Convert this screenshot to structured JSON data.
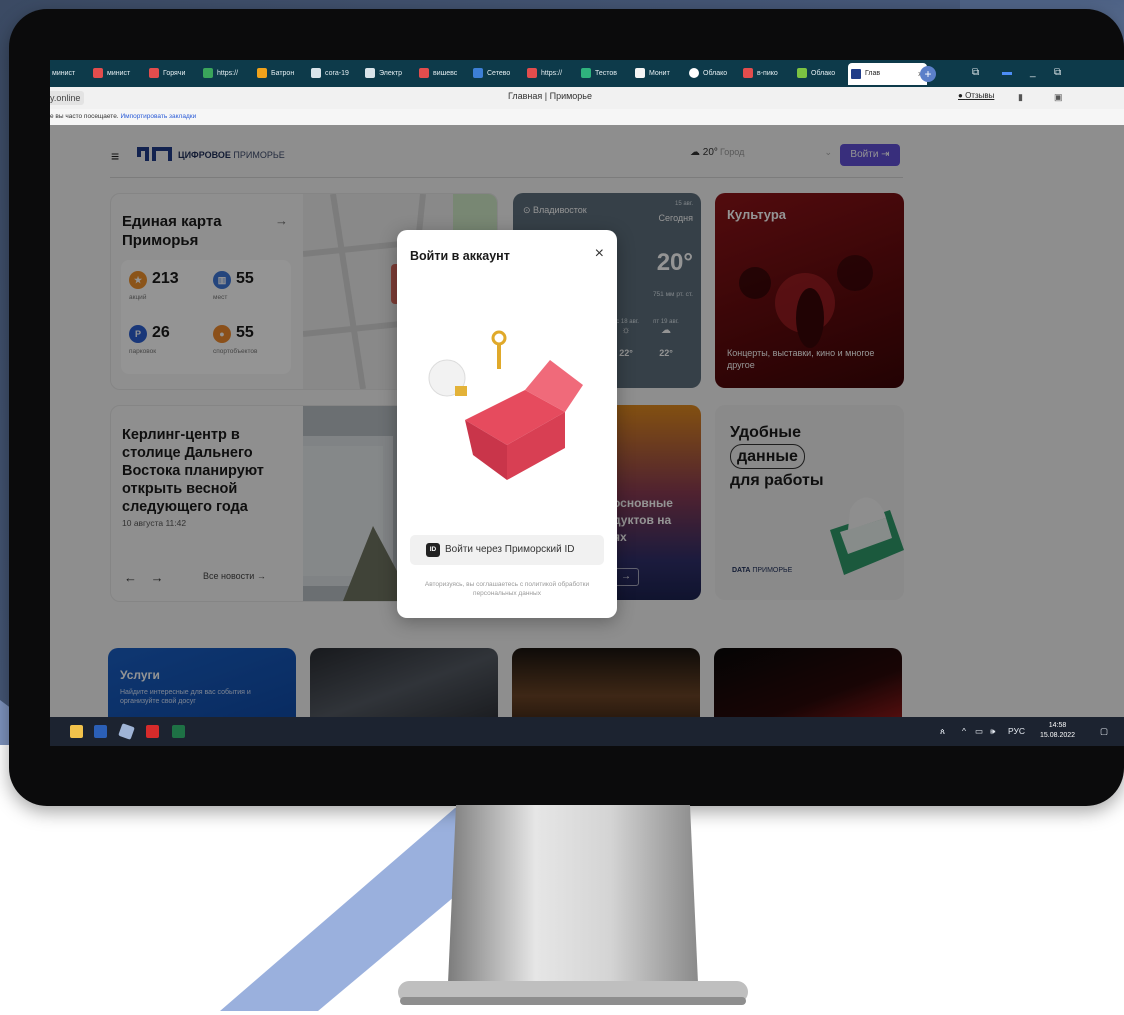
{
  "browser": {
    "tabs": [
      "минист",
      "Горячи",
      "https://",
      "Батрон",
      "сога-19",
      "Электр",
      "вишевс",
      "Сетево",
      "https://",
      "Тестов",
      "Монит",
      "Облако",
      "в-пико",
      "Облако",
      "Глав"
    ],
    "url": "y.online",
    "page_title": "Главная | Приморье",
    "feedback": "Отзывы",
    "bookmarks_text": "е вы часто посещаете.",
    "bookmarks_link": "Импортировать закладки"
  },
  "site": {
    "brand_bold": "ЦИФРОВОЕ",
    "brand_light": "ПРИМОРЬЕ",
    "temperature": "20°",
    "city_placeholder": "Город",
    "login": "Войти"
  },
  "map_card": {
    "title": "Единая карта Приморья",
    "stats": [
      {
        "value": "213",
        "label": "акций"
      },
      {
        "value": "55",
        "label": "мест"
      },
      {
        "value": "26",
        "label": "парковок"
      },
      {
        "value": "55",
        "label": "спортобъектов"
      }
    ]
  },
  "weather_card": {
    "city": "Владивосток",
    "date": "15 авг.",
    "today": "Сегодня",
    "temp": "20°",
    "pressure": "751 мм рт. ст.",
    "forecast": [
      {
        "day": "вс",
        "date": "18 авг.",
        "temp": "22°"
      },
      {
        "day": "пт",
        "date": "19 авг.",
        "temp": "22°"
      }
    ]
  },
  "culture_card": {
    "title": "Культура",
    "subtitle": "Концерты, выставки, кино и многое другое"
  },
  "news_card": {
    "title": "Керлинг-центр в столице Дальнего Востока планируют открыть весной следующего года",
    "date": "10 августа 11:42",
    "nav": "← →",
    "all_news": "Все новости →"
  },
  "promo_card": {
    "line1": "основные",
    "line2": "дуктов на",
    "line3": "ях"
  },
  "data_card": {
    "line1": "Удобные",
    "line2": "данные",
    "line3": "для работы",
    "logo_bold": "DATA",
    "logo_light": "ПРИМОРЬЕ"
  },
  "services_card": {
    "title": "Услуги",
    "subtitle": "Найдите интересные для вас события и организуйте свой досуг"
  },
  "modal": {
    "title": "Войти в аккаунт",
    "close": "×",
    "id_badge": "ID",
    "id_button": "Войти через Приморский ID",
    "note": "Авторизуясь, вы соглашаетесь с политикой обработки персональных данных"
  },
  "taskbar": {
    "lang": "РУС",
    "time": "14:58",
    "date": "15.08.2022"
  }
}
